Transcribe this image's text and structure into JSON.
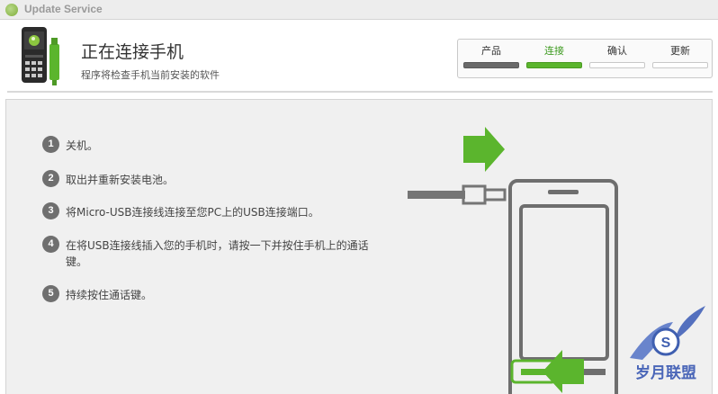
{
  "window": {
    "title": "Update Service"
  },
  "header": {
    "heading": "正在连接手机",
    "subheading": "程序将检查手机当前安装的软件"
  },
  "steps": [
    {
      "label": "产品",
      "state": "done"
    },
    {
      "label": "连接",
      "state": "active"
    },
    {
      "label": "确认",
      "state": "pending"
    },
    {
      "label": "更新",
      "state": "pending"
    }
  ],
  "instructions": [
    {
      "num": "1",
      "text": "关机。"
    },
    {
      "num": "2",
      "text": "取出并重新安装电池。"
    },
    {
      "num": "3",
      "text": "将Micro-USB连接线连接至您PC上的USB连接端口。"
    },
    {
      "num": "4",
      "text": "在将USB连接线插入您的手机时，请按一下并按住手机上的通话键。"
    },
    {
      "num": "5",
      "text": "持续按住通话键。"
    }
  ],
  "watermark": {
    "letter": "S",
    "text": "岁月联盟"
  },
  "icons": {
    "app": "sony-ericsson-logo-icon",
    "arrow_right": "arrow-right-icon",
    "arrow_left": "arrow-left-icon"
  },
  "colors": {
    "accent_green": "#5bb52d",
    "done_gray": "#6a6a6a",
    "panel_bg": "#f0f0f0"
  }
}
